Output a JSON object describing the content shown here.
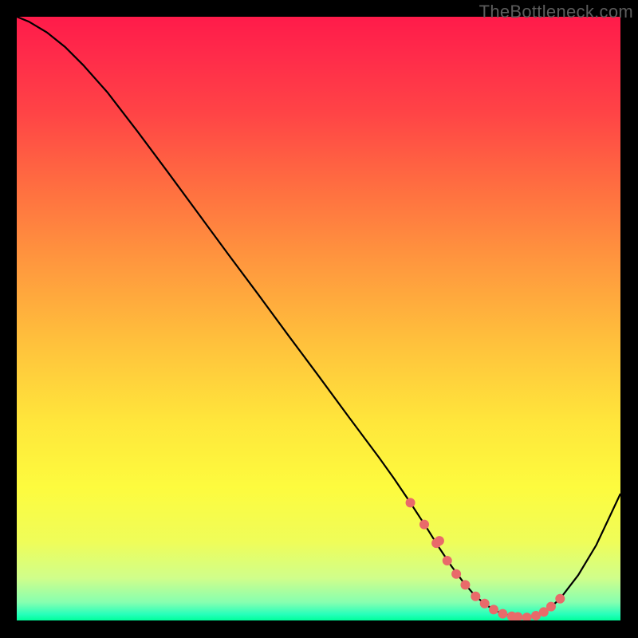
{
  "watermark": "TheBottleneck.com",
  "colors": {
    "background": "#000000",
    "curve": "#000000",
    "marker": "#e96a6a",
    "gradient_top": "#ff1b4a",
    "gradient_bottom": "#00ff9b"
  },
  "chart_data": {
    "type": "line",
    "title": "",
    "xlabel": "",
    "ylabel": "",
    "xlim": [
      0,
      100
    ],
    "ylim": [
      0,
      100
    ],
    "x": [
      0,
      2,
      5,
      8,
      11,
      15,
      20,
      25,
      30,
      35,
      40,
      45,
      50,
      55,
      60,
      62.5,
      65,
      68,
      70,
      72,
      74,
      76,
      78,
      80,
      82,
      84,
      86,
      88,
      90,
      93,
      96,
      100
    ],
    "y": [
      100,
      99.2,
      97.4,
      95,
      92,
      87.5,
      81,
      74.3,
      67.5,
      60.7,
      54,
      47.2,
      40.5,
      33.7,
      27,
      23.5,
      19.8,
      15.2,
      12,
      9,
      6.3,
      4,
      2.4,
      1.3,
      0.7,
      0.5,
      0.8,
      1.8,
      3.6,
      7.5,
      12.5,
      21
    ],
    "markers": {
      "x": [
        65.2,
        67.5,
        69.5,
        70,
        71.3,
        72.8,
        74.3,
        76,
        77.5,
        79,
        80.5,
        82,
        83,
        84.5,
        86,
        87.3,
        88.5,
        90
      ],
      "y": [
        19.5,
        15.9,
        12.8,
        13.2,
        9.9,
        7.7,
        5.9,
        4.0,
        2.8,
        1.8,
        1.1,
        0.7,
        0.6,
        0.5,
        0.8,
        1.4,
        2.3,
        3.6
      ]
    }
  }
}
